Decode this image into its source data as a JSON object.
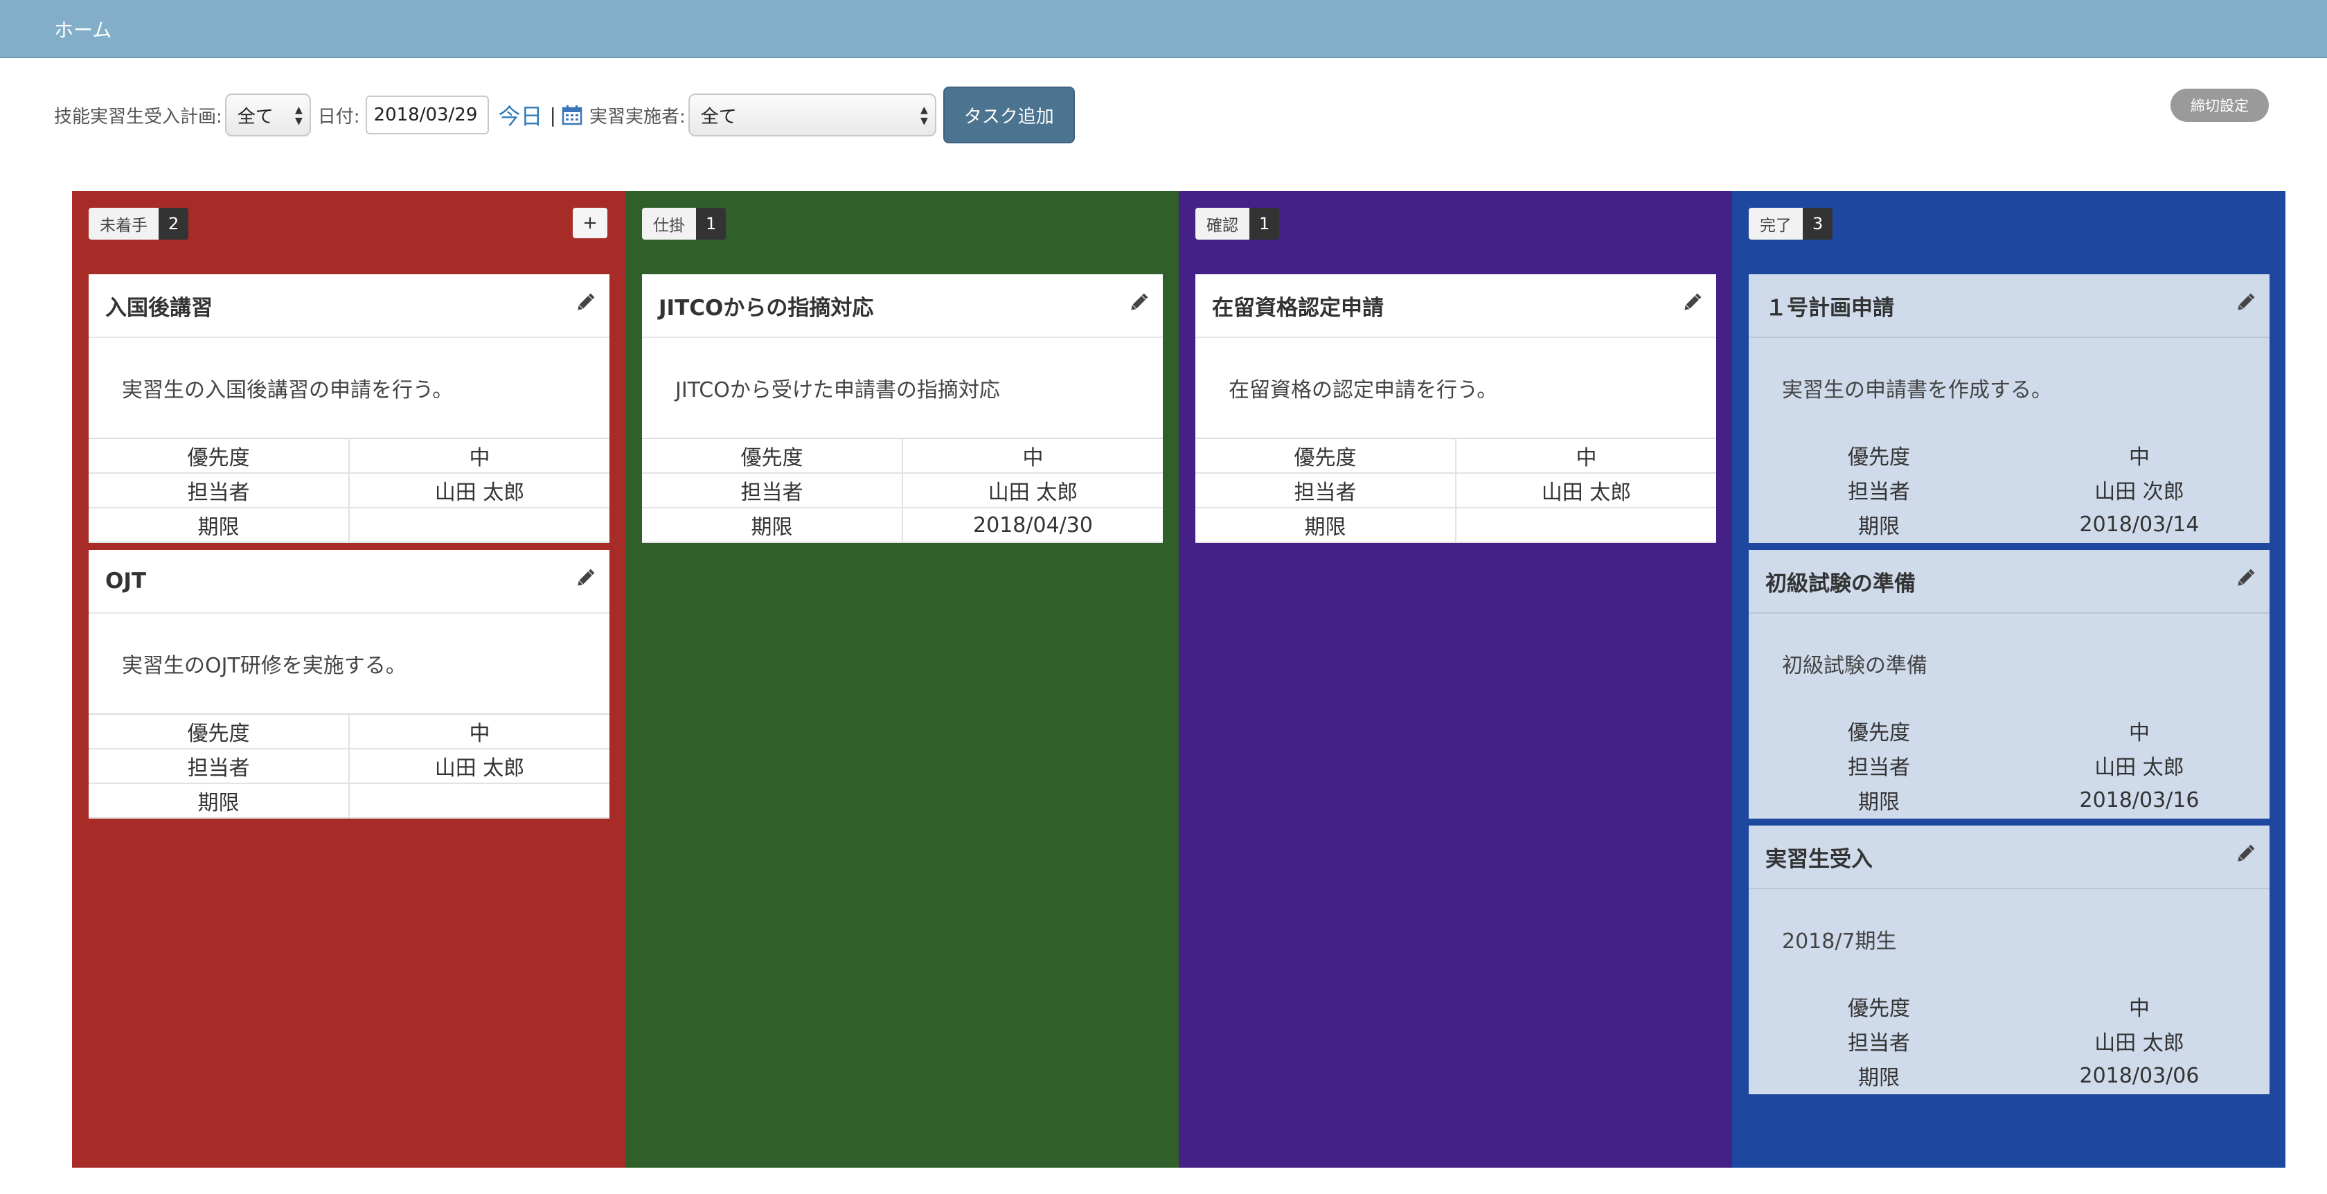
{
  "header": {
    "home_label": "ホーム"
  },
  "toolbar": {
    "plan_label": "技能実習生受入計画:",
    "plan_value": "全て",
    "date_label": "日付:",
    "date_value": "2018/03/29",
    "today_link": "今日",
    "separator": "|",
    "trainer_label": "実習実施者:",
    "trainer_value": "全て",
    "add_task_label": "タスク追加",
    "deadline_settings_label": "締切設定"
  },
  "colors": {
    "topbar": "#83aec9",
    "col_todo": "#a72c28",
    "col_doing": "#305f2b",
    "col_review": "#452087",
    "col_done": "#1e48a0"
  },
  "columns": [
    {
      "name": "未着手",
      "count": "2",
      "color": "#a72c28",
      "add_button": "+",
      "cards": [
        {
          "title": "入国後講習",
          "desc": "実習生の入国後講習の申請を行う。",
          "priority_label": "優先度",
          "priority": "中",
          "assignee_label": "担当者",
          "assignee": "山田 太郎",
          "due_label": "期限",
          "due": ""
        },
        {
          "title": "OJT",
          "desc": "実習生のOJT研修を実施する。",
          "priority_label": "優先度",
          "priority": "中",
          "assignee_label": "担当者",
          "assignee": "山田 太郎",
          "due_label": "期限",
          "due": ""
        }
      ]
    },
    {
      "name": "仕掛",
      "count": "1",
      "color": "#305f2b",
      "cards": [
        {
          "title": "JITCOからの指摘対応",
          "desc": "JITCOから受けた申請書の指摘対応",
          "priority_label": "優先度",
          "priority": "中",
          "assignee_label": "担当者",
          "assignee": "山田 太郎",
          "due_label": "期限",
          "due": "2018/04/30"
        }
      ]
    },
    {
      "name": "確認",
      "count": "1",
      "color": "#452087",
      "cards": [
        {
          "title": "在留資格認定申請",
          "desc": "在留資格の認定申請を行う。",
          "priority_label": "優先度",
          "priority": "中",
          "assignee_label": "担当者",
          "assignee": "山田 太郎",
          "due_label": "期限",
          "due": ""
        }
      ]
    },
    {
      "name": "完了",
      "count": "3",
      "color": "#1e48a0",
      "cards": [
        {
          "title": "１号計画申請",
          "desc": "実習生の申請書を作成する。",
          "priority_label": "優先度",
          "priority": "中",
          "assignee_label": "担当者",
          "assignee": "山田 次郎",
          "due_label": "期限",
          "due": "2018/03/14"
        },
        {
          "title": "初級試験の準備",
          "desc": "初級試験の準備",
          "priority_label": "優先度",
          "priority": "中",
          "assignee_label": "担当者",
          "assignee": "山田 太郎",
          "due_label": "期限",
          "due": "2018/03/16"
        },
        {
          "title": "実習生受入",
          "desc": "2018/7期生",
          "priority_label": "優先度",
          "priority": "中",
          "assignee_label": "担当者",
          "assignee": "山田 太郎",
          "due_label": "期限",
          "due": "2018/03/06"
        }
      ]
    }
  ]
}
